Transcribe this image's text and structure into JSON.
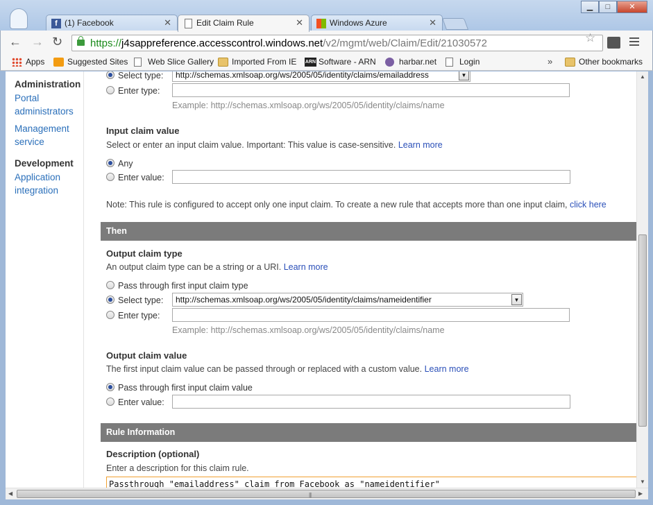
{
  "browser": {
    "tabs": [
      {
        "label": "(1) Facebook",
        "icon": "facebook-icon",
        "active": false
      },
      {
        "label": "Edit Claim Rule",
        "icon": "page-icon",
        "active": true
      },
      {
        "label": "Windows Azure",
        "icon": "windows-azure-icon",
        "active": false
      }
    ],
    "url": {
      "scheme": "https://",
      "host": "j4sappreference.accesscontrol.windows.net",
      "path": "/v2/mgmt/web/Claim/Edit/21030572"
    },
    "bookmarks": [
      "Apps",
      "Suggested Sites",
      "Web Slice Gallery",
      "Imported From IE",
      "Software - ARN",
      "harbar.net",
      "Login"
    ],
    "bookmarks_more": "»",
    "other_bookmarks": "Other bookmarks",
    "arn_icon_text": "ARN"
  },
  "sidebar": {
    "administration": {
      "heading": "Administration",
      "items": [
        "Portal",
        "administrators",
        "Management",
        "service"
      ]
    },
    "development": {
      "heading": "Development",
      "items": [
        "Application",
        "integration"
      ]
    }
  },
  "input_claim_type": {
    "select_label": "Select type:",
    "select_value": "http://schemas.xmlsoap.org/ws/2005/05/identity/claims/emailaddress",
    "enter_label": "Enter type:",
    "enter_value": "",
    "example": "Example: http://schemas.xmlsoap.org/ws/2005/05/identity/claims/name"
  },
  "input_claim_value": {
    "title": "Input claim value",
    "description": "Select or enter an input claim value. Important: This value is case-sensitive.",
    "learn_more": "Learn more",
    "any_label": "Any",
    "enter_label": "Enter value:",
    "enter_value": "",
    "note": "Note: This rule is configured to accept only one input claim. To create a new rule that accepts more than one input claim,",
    "note_link": "click here"
  },
  "then_section": {
    "heading": "Then"
  },
  "output_claim_type": {
    "title": "Output claim type",
    "description": "An output claim type can be a string or a URI.",
    "learn_more": "Learn more",
    "pass_through_label": "Pass through first input claim type",
    "select_label": "Select type:",
    "select_value": "http://schemas.xmlsoap.org/ws/2005/05/identity/claims/nameidentifier",
    "enter_label": "Enter type:",
    "enter_value": "",
    "example": "Example: http://schemas.xmlsoap.org/ws/2005/05/identity/claims/name"
  },
  "output_claim_value": {
    "title": "Output claim value",
    "description": "The first input claim value can be passed through or replaced with a custom value.",
    "learn_more": "Learn more",
    "pass_through_label": "Pass through first input claim value",
    "enter_label": "Enter value:",
    "enter_value": ""
  },
  "rule_information": {
    "heading": "Rule Information",
    "title": "Description (optional)",
    "description": "Enter a description for this claim rule.",
    "value": "Passthrough \"emailaddress\" claim from Facebook as \"nameidentifier\""
  },
  "colors": {
    "link": "#2a4fb8",
    "sidebar_link": "#2a6fba",
    "band": "#7b7b7b",
    "focus_border": "#f0a030"
  }
}
